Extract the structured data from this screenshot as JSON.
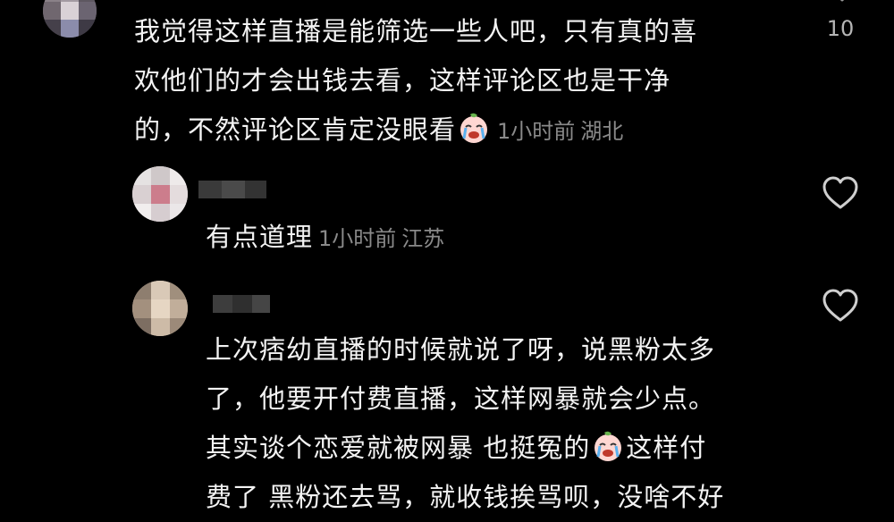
{
  "comments": {
    "top": {
      "text_line1": "我觉得这样直播是能筛选一些人吧，只有真的喜",
      "text_line2": "欢他们的才会出钱去看，这样评论区也是干净",
      "text_line3": "的，不然评论区肯定没眼看",
      "time": "1小时前",
      "location": "湖北",
      "like_count": "10",
      "emoji": "crying-face-emoji"
    },
    "replies": [
      {
        "text_line1": "有点道理",
        "time": "1小时前",
        "location": "江苏",
        "like_icon": "heart-outline-icon"
      },
      {
        "text_line1": "上次痞幼直播的时候就说了呀，说黑粉太多",
        "text_line2": "了，他要开付费直播，这样网暴就会少点。",
        "text_line3a": "其实谈个恋爱就被网暴 也挺冤的",
        "text_line3b": "这样付",
        "text_line4": "费了 黑粉还去骂，就收钱挨骂呗，没啥不好",
        "emoji": "crying-face-emoji",
        "like_icon": "heart-outline-icon"
      }
    ]
  },
  "colors": {
    "background": "#000000",
    "text": "#f3f3f3",
    "meta": "#8a8a8a"
  }
}
